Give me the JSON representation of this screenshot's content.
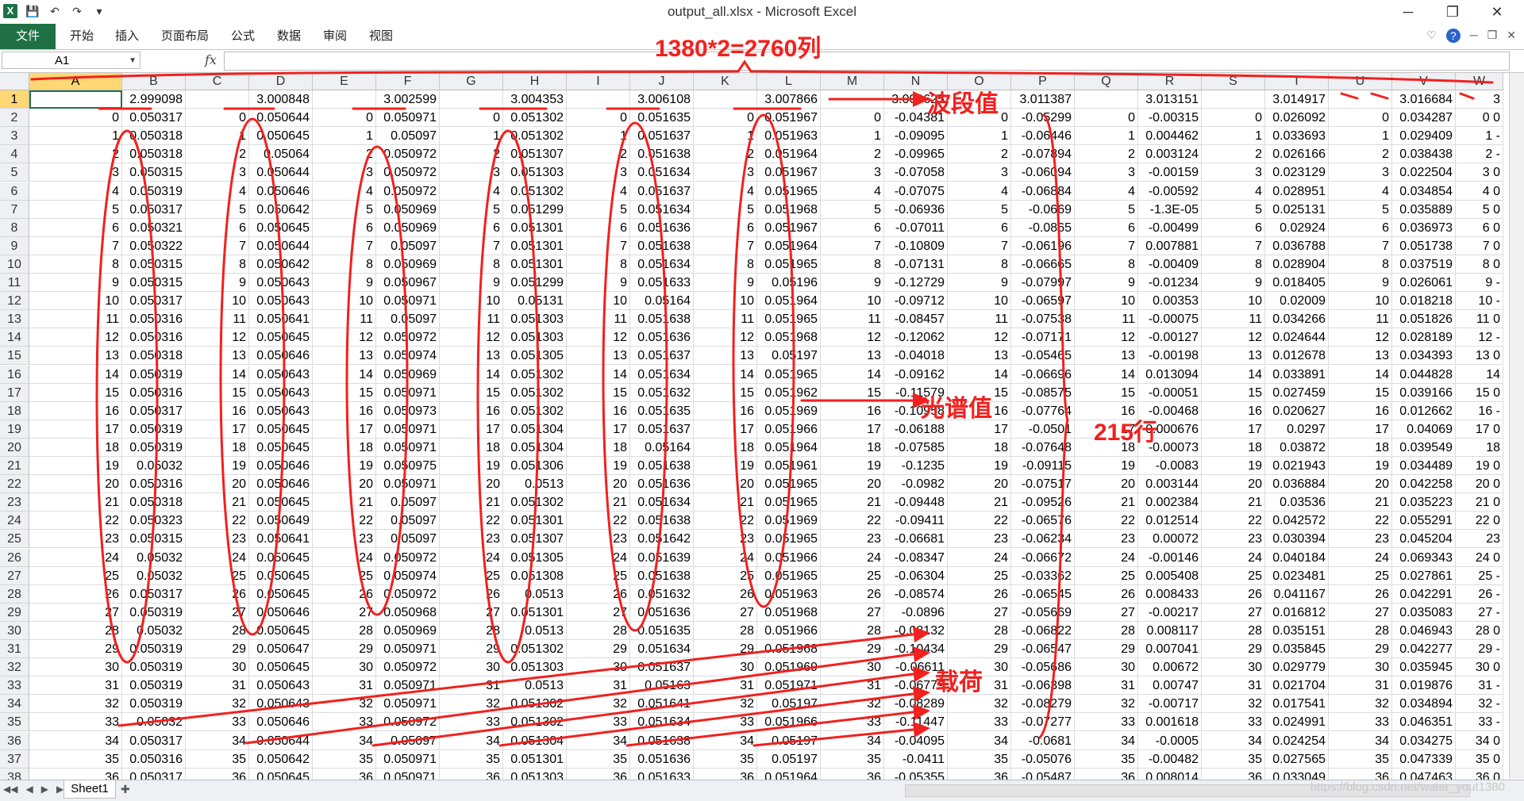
{
  "window": {
    "title": "output_all.xlsx - Microsoft Excel",
    "controls": [
      "─",
      "❐",
      "✕"
    ]
  },
  "ribbon": {
    "file": "文件",
    "tabs": [
      "开始",
      "插入",
      "页面布局",
      "公式",
      "数据",
      "审阅",
      "视图"
    ]
  },
  "formula_bar": {
    "name_box": "A1",
    "fx": "fx",
    "value": ""
  },
  "columns": [
    "A",
    "B",
    "C",
    "D",
    "E",
    "F",
    "G",
    "H",
    "I",
    "J",
    "K",
    "L",
    "M",
    "N",
    "O",
    "P",
    "Q",
    "R",
    "S",
    "T",
    "U",
    "V",
    "W"
  ],
  "row_numbers": [
    "1",
    "2",
    "3",
    "4",
    "5",
    "6",
    "7",
    "8",
    "9",
    "10",
    "11",
    "12",
    "13",
    "14",
    "15",
    "16",
    "17",
    "18",
    "19",
    "20",
    "21",
    "22",
    "23",
    "24",
    "25",
    "26",
    "27",
    "28",
    "29",
    "30",
    "31",
    "32",
    "33",
    "34",
    "35",
    "36",
    "37",
    "38"
  ],
  "rows": [
    [
      "",
      "2.999098",
      "",
      "3.000848",
      "",
      "3.002599",
      "",
      "3.004353",
      "",
      "3.006108",
      "",
      "3.007866",
      "",
      "3.009625",
      "",
      "3.011387",
      "",
      "3.013151",
      "",
      "3.014917",
      "",
      "3.016684",
      "3"
    ],
    [
      "0",
      "0.050317",
      "0",
      "0.050644",
      "0",
      "0.050971",
      "0",
      "0.051302",
      "0",
      "0.051635",
      "0",
      "0.051967",
      "0",
      "-0.04381",
      "0",
      "-0.05299",
      "0",
      "-0.00315",
      "0",
      "0.026092",
      "0",
      "0.034287",
      "0 0"
    ],
    [
      "1",
      "0.050318",
      "1",
      "0.050645",
      "1",
      "0.05097",
      "1",
      "0.051302",
      "1",
      "0.051637",
      "1",
      "0.051963",
      "1",
      "-0.09095",
      "1",
      "-0.06446",
      "1",
      "0.004462",
      "1",
      "0.033693",
      "1",
      "0.029409",
      "1 -"
    ],
    [
      "2",
      "0.050318",
      "2",
      "0.05064",
      "2",
      "0.050972",
      "2",
      "0.051307",
      "2",
      "0.051638",
      "2",
      "0.051964",
      "2",
      "-0.09965",
      "2",
      "-0.07894",
      "2",
      "0.003124",
      "2",
      "0.026166",
      "2",
      "0.038438",
      "2 -"
    ],
    [
      "3",
      "0.050315",
      "3",
      "0.050644",
      "3",
      "0.050972",
      "3",
      "0.051303",
      "3",
      "0.051634",
      "3",
      "0.051967",
      "3",
      "-0.07058",
      "3",
      "-0.06094",
      "3",
      "-0.00159",
      "3",
      "0.023129",
      "3",
      "0.022504",
      "3 0"
    ],
    [
      "4",
      "0.050319",
      "4",
      "0.050646",
      "4",
      "0.050972",
      "4",
      "0.051302",
      "4",
      "0.051637",
      "4",
      "0.051965",
      "4",
      "-0.07075",
      "4",
      "-0.06884",
      "4",
      "-0.00592",
      "4",
      "0.028951",
      "4",
      "0.034854",
      "4 0"
    ],
    [
      "5",
      "0.050317",
      "5",
      "0.050642",
      "5",
      "0.050969",
      "5",
      "0.051299",
      "5",
      "0.051634",
      "5",
      "0.051968",
      "5",
      "-0.06936",
      "5",
      "-0.0669",
      "5",
      "-1.3E-05",
      "5",
      "0.025131",
      "5",
      "0.035889",
      "5 0"
    ],
    [
      "6",
      "0.050321",
      "6",
      "0.050645",
      "6",
      "0.050969",
      "6",
      "0.051301",
      "6",
      "0.051636",
      "6",
      "0.051967",
      "6",
      "-0.07011",
      "6",
      "-0.0865",
      "6",
      "-0.00499",
      "6",
      "0.02924",
      "6",
      "0.036973",
      "6 0"
    ],
    [
      "7",
      "0.050322",
      "7",
      "0.050644",
      "7",
      "0.05097",
      "7",
      "0.051301",
      "7",
      "0.051638",
      "7",
      "0.051964",
      "7",
      "-0.10809",
      "7",
      "-0.06196",
      "7",
      "0.007881",
      "7",
      "0.036788",
      "7",
      "0.051738",
      "7 0"
    ],
    [
      "8",
      "0.050315",
      "8",
      "0.050642",
      "8",
      "0.050969",
      "8",
      "0.051301",
      "8",
      "0.051634",
      "8",
      "0.051965",
      "8",
      "-0.07131",
      "8",
      "-0.06665",
      "8",
      "-0.00409",
      "8",
      "0.028904",
      "8",
      "0.037519",
      "8 0"
    ],
    [
      "9",
      "0.050315",
      "9",
      "0.050643",
      "9",
      "0.050967",
      "9",
      "0.051299",
      "9",
      "0.051633",
      "9",
      "0.05196",
      "9",
      "-0.12729",
      "9",
      "-0.07997",
      "9",
      "-0.01234",
      "9",
      "0.018405",
      "9",
      "0.026061",
      "9 -"
    ],
    [
      "10",
      "0.050317",
      "10",
      "0.050643",
      "10",
      "0.050971",
      "10",
      "0.05131",
      "10",
      "0.05164",
      "10",
      "0.051964",
      "10",
      "-0.09712",
      "10",
      "-0.06597",
      "10",
      "0.00353",
      "10",
      "0.02009",
      "10",
      "0.018218",
      "10 -"
    ],
    [
      "11",
      "0.050316",
      "11",
      "0.050641",
      "11",
      "0.05097",
      "11",
      "0.051303",
      "11",
      "0.051638",
      "11",
      "0.051965",
      "11",
      "-0.08457",
      "11",
      "-0.07538",
      "11",
      "-0.00075",
      "11",
      "0.034266",
      "11",
      "0.051826",
      "11 0"
    ],
    [
      "12",
      "0.050316",
      "12",
      "0.050645",
      "12",
      "0.050972",
      "12",
      "0.051303",
      "12",
      "0.051636",
      "12",
      "0.051968",
      "12",
      "-0.12062",
      "12",
      "-0.07171",
      "12",
      "-0.00127",
      "12",
      "0.024644",
      "12",
      "0.028189",
      "12 -"
    ],
    [
      "13",
      "0.050318",
      "13",
      "0.050646",
      "13",
      "0.050974",
      "13",
      "0.051305",
      "13",
      "0.051637",
      "13",
      "0.05197",
      "13",
      "-0.04018",
      "13",
      "-0.05465",
      "13",
      "-0.00198",
      "13",
      "0.012678",
      "13",
      "0.034393",
      "13 0"
    ],
    [
      "14",
      "0.050319",
      "14",
      "0.050643",
      "14",
      "0.050969",
      "14",
      "0.051302",
      "14",
      "0.051634",
      "14",
      "0.051965",
      "14",
      "-0.09162",
      "14",
      "-0.06696",
      "14",
      "0.013094",
      "14",
      "0.033891",
      "14",
      "0.044828",
      "14"
    ],
    [
      "15",
      "0.050316",
      "15",
      "0.050643",
      "15",
      "0.050971",
      "15",
      "0.051302",
      "15",
      "0.051632",
      "15",
      "0.051962",
      "15",
      "-0.11579",
      "15",
      "-0.08575",
      "15",
      "-0.00051",
      "15",
      "0.027459",
      "15",
      "0.039166",
      "15 0"
    ],
    [
      "16",
      "0.050317",
      "16",
      "0.050643",
      "16",
      "0.050973",
      "16",
      "0.051302",
      "16",
      "0.051635",
      "16",
      "0.051969",
      "16",
      "-0.10958",
      "16",
      "-0.07764",
      "16",
      "-0.00468",
      "16",
      "0.020627",
      "16",
      "0.012662",
      "16 -"
    ],
    [
      "17",
      "0.050319",
      "17",
      "0.050645",
      "17",
      "0.050971",
      "17",
      "0.051304",
      "17",
      "0.051637",
      "17",
      "0.051966",
      "17",
      "-0.06188",
      "17",
      "-0.0501",
      "17",
      "0.000676",
      "17",
      "0.0297",
      "17",
      "0.04069",
      "17 0"
    ],
    [
      "18",
      "0.050319",
      "18",
      "0.050645",
      "18",
      "0.050971",
      "18",
      "0.051304",
      "18",
      "0.05164",
      "18",
      "0.051964",
      "18",
      "-0.07585",
      "18",
      "-0.07648",
      "18",
      "-0.00073",
      "18",
      "0.03872",
      "18",
      "0.039549",
      "18"
    ],
    [
      "19",
      "0.05032",
      "19",
      "0.050646",
      "19",
      "0.050975",
      "19",
      "0.051306",
      "19",
      "0.051638",
      "19",
      "0.051961",
      "19",
      "-0.1235",
      "19",
      "-0.09115",
      "19",
      "-0.0083",
      "19",
      "0.021943",
      "19",
      "0.034489",
      "19 0"
    ],
    [
      "20",
      "0.050316",
      "20",
      "0.050646",
      "20",
      "0.050971",
      "20",
      "0.0513",
      "20",
      "0.051636",
      "20",
      "0.051965",
      "20",
      "-0.0982",
      "20",
      "-0.07517",
      "20",
      "0.003144",
      "20",
      "0.036884",
      "20",
      "0.042258",
      "20 0"
    ],
    [
      "21",
      "0.050318",
      "21",
      "0.050645",
      "21",
      "0.05097",
      "21",
      "0.051302",
      "21",
      "0.051634",
      "21",
      "0.051965",
      "21",
      "-0.09448",
      "21",
      "-0.09526",
      "21",
      "0.002384",
      "21",
      "0.03536",
      "21",
      "0.035223",
      "21 0"
    ],
    [
      "22",
      "0.050323",
      "22",
      "0.050649",
      "22",
      "0.05097",
      "22",
      "0.051301",
      "22",
      "0.051638",
      "22",
      "0.051969",
      "22",
      "-0.09411",
      "22",
      "-0.06576",
      "22",
      "0.012514",
      "22",
      "0.042572",
      "22",
      "0.055291",
      "22 0"
    ],
    [
      "23",
      "0.050315",
      "23",
      "0.050641",
      "23",
      "0.05097",
      "23",
      "0.051307",
      "23",
      "0.051642",
      "23",
      "0.051965",
      "23",
      "-0.06681",
      "23",
      "-0.06234",
      "23",
      "0.00072",
      "23",
      "0.030394",
      "23",
      "0.045204",
      "23"
    ],
    [
      "24",
      "0.05032",
      "24",
      "0.050645",
      "24",
      "0.050972",
      "24",
      "0.051305",
      "24",
      "0.051639",
      "24",
      "0.051966",
      "24",
      "-0.08347",
      "24",
      "-0.06672",
      "24",
      "-0.00146",
      "24",
      "0.040184",
      "24",
      "0.069343",
      "24 0"
    ],
    [
      "25",
      "0.05032",
      "25",
      "0.050645",
      "25",
      "0.050974",
      "25",
      "0.051308",
      "25",
      "0.051638",
      "25",
      "0.051965",
      "25",
      "-0.06304",
      "25",
      "-0.03362",
      "25",
      "0.005408",
      "25",
      "0.023481",
      "25",
      "0.027861",
      "25 -"
    ],
    [
      "26",
      "0.050317",
      "26",
      "0.050645",
      "26",
      "0.050972",
      "26",
      "0.0513",
      "26",
      "0.051632",
      "26",
      "0.051963",
      "26",
      "-0.08574",
      "26",
      "-0.06545",
      "26",
      "0.008433",
      "26",
      "0.041167",
      "26",
      "0.042291",
      "26 -"
    ],
    [
      "27",
      "0.050319",
      "27",
      "0.050646",
      "27",
      "0.050968",
      "27",
      "0.051301",
      "27",
      "0.051636",
      "27",
      "0.051968",
      "27",
      "-0.0896",
      "27",
      "-0.05669",
      "27",
      "-0.00217",
      "27",
      "0.016812",
      "27",
      "0.035083",
      "27 -"
    ],
    [
      "28",
      "0.05032",
      "28",
      "0.050645",
      "28",
      "0.050969",
      "28",
      "0.0513",
      "28",
      "0.051635",
      "28",
      "0.051966",
      "28",
      "-0.08132",
      "28",
      "-0.06822",
      "28",
      "0.008117",
      "28",
      "0.035151",
      "28",
      "0.046943",
      "28 0"
    ],
    [
      "29",
      "0.050319",
      "29",
      "0.050647",
      "29",
      "0.050971",
      "29",
      "0.051302",
      "29",
      "0.051634",
      "29",
      "0.051968",
      "29",
      "-0.10434",
      "29",
      "-0.06547",
      "29",
      "0.007041",
      "29",
      "0.035845",
      "29",
      "0.042277",
      "29 -"
    ],
    [
      "30",
      "0.050319",
      "30",
      "0.050645",
      "30",
      "0.050972",
      "30",
      "0.051303",
      "30",
      "0.051637",
      "30",
      "0.051969",
      "30",
      "-0.06611",
      "30",
      "-0.05686",
      "30",
      "0.00672",
      "30",
      "0.029779",
      "30",
      "0.035945",
      "30 0"
    ],
    [
      "31",
      "0.050319",
      "31",
      "0.050643",
      "31",
      "0.050971",
      "31",
      "0.0513",
      "31",
      "0.05163",
      "31",
      "0.051971",
      "31",
      "-0.06779",
      "31",
      "-0.06398",
      "31",
      "0.00747",
      "31",
      "0.021704",
      "31",
      "0.019876",
      "31 -"
    ],
    [
      "32",
      "0.050319",
      "32",
      "0.050643",
      "32",
      "0.050971",
      "32",
      "0.051302",
      "32",
      "0.051641",
      "32",
      "0.05197",
      "32",
      "-0.08289",
      "32",
      "-0.08279",
      "32",
      "-0.00717",
      "32",
      "0.017541",
      "32",
      "0.034894",
      "32 -"
    ],
    [
      "33",
      "0.05032",
      "33",
      "0.050646",
      "33",
      "0.050972",
      "33",
      "0.051302",
      "33",
      "0.051634",
      "33",
      "0.051966",
      "33",
      "-0.11447",
      "33",
      "-0.07277",
      "33",
      "0.001618",
      "33",
      "0.024991",
      "33",
      "0.046351",
      "33 -"
    ],
    [
      "34",
      "0.050317",
      "34",
      "0.050644",
      "34",
      "0.05097",
      "34",
      "0.051304",
      "34",
      "0.051638",
      "34",
      "0.05197",
      "34",
      "-0.04095",
      "34",
      "-0.0681",
      "34",
      "-0.0005",
      "34",
      "0.024254",
      "34",
      "0.034275",
      "34 0"
    ],
    [
      "35",
      "0.050316",
      "35",
      "0.050642",
      "35",
      "0.050971",
      "35",
      "0.051301",
      "35",
      "0.051636",
      "35",
      "0.05197",
      "35",
      "-0.0411",
      "35",
      "-0.05076",
      "35",
      "-0.00482",
      "35",
      "0.027565",
      "35",
      "0.047339",
      "35 0"
    ],
    [
      "36",
      "0.050317",
      "36",
      "0.050645",
      "36",
      "0.050971",
      "36",
      "0.051303",
      "36",
      "0.051633",
      "36",
      "0.051964",
      "36",
      "-0.05355",
      "36",
      "-0.05487",
      "36",
      "0.008014",
      "36",
      "0.033049",
      "36",
      "0.047463",
      "36 0"
    ]
  ],
  "sheet": {
    "tab": "Sheet1"
  },
  "annotations": {
    "columns_count": "1380*2=2760列",
    "band_value": "波段值",
    "spectrum_value": "光谱值",
    "rows_count": "215行",
    "loading": "载荷"
  },
  "watermark": "https://blog.csdn.net/water_yout1380",
  "colors": {
    "excel_green": "#1f7145",
    "annotation_red": "#f2201e",
    "selected_header": "#ffd775"
  }
}
